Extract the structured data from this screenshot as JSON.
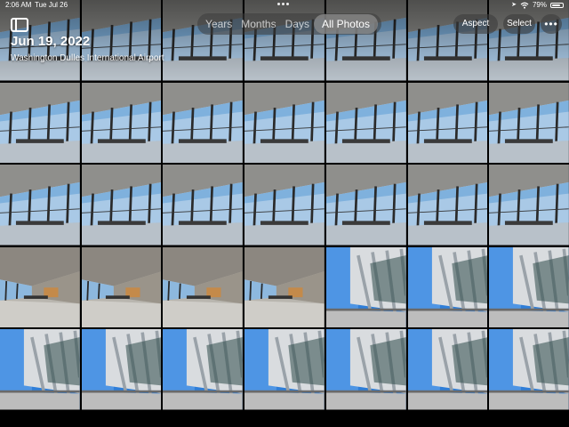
{
  "status_bar": {
    "time": "2:06 AM",
    "date": "Tue Jul 26",
    "battery_text": "79%",
    "battery_level": 0.79
  },
  "header": {
    "date": "Jun 19, 2022",
    "location": "Washington Dulles International Airport"
  },
  "view_switcher": {
    "options": [
      "Years",
      "Months",
      "Days",
      "All Photos"
    ],
    "selected": "All Photos"
  },
  "toolbar": {
    "aspect_label": "Aspect",
    "select_label": "Select",
    "more_label": "•••"
  },
  "icons": {
    "sidebar": "sidebar-icon",
    "wifi": "wifi-icon",
    "location": "location-arrow-icon",
    "battery": "battery-icon",
    "more": "ellipsis-icon"
  },
  "colors": {
    "background": "#000000",
    "text": "#ffffff",
    "control_bg": "#3c3c3c"
  },
  "photo_grid": {
    "columns": 7,
    "rows": [
      [
        "terminal-window",
        "terminal-window",
        "terminal-window",
        "terminal-window",
        "terminal-window",
        "terminal-window",
        "terminal-window"
      ],
      [
        "terminal-window",
        "terminal-window",
        "terminal-window",
        "terminal-window",
        "terminal-window",
        "terminal-window",
        "terminal-window"
      ],
      [
        "terminal-window",
        "terminal-window",
        "terminal-window",
        "terminal-window",
        "terminal-window",
        "terminal-window",
        "terminal-window"
      ],
      [
        "terminal-interior",
        "terminal-interior",
        "terminal-interior",
        "terminal-interior",
        "terminal-exterior",
        "terminal-exterior",
        "terminal-exterior"
      ],
      [
        "terminal-exterior",
        "terminal-exterior",
        "terminal-exterior",
        "terminal-exterior",
        "terminal-exterior",
        "terminal-exterior",
        "terminal-exterior"
      ]
    ]
  }
}
